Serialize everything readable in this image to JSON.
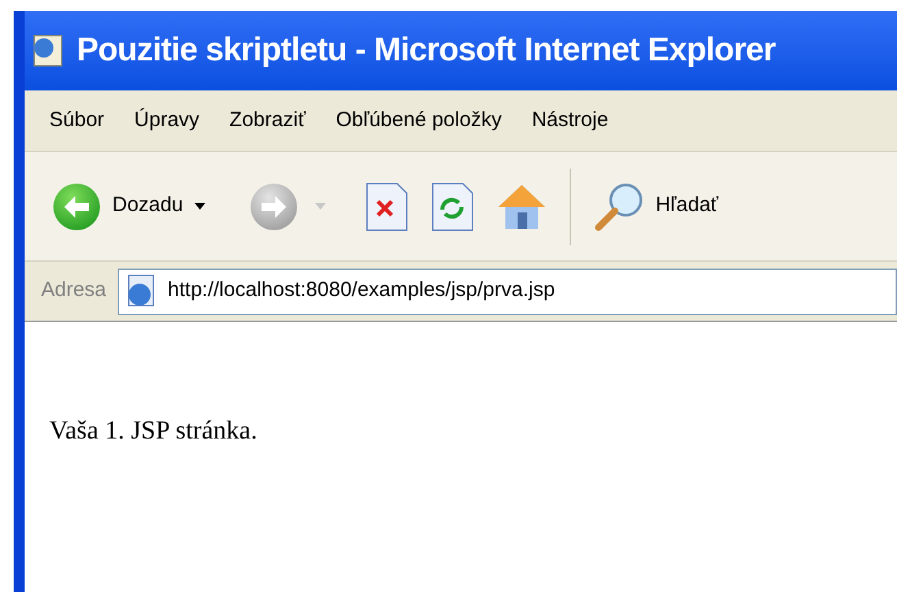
{
  "window": {
    "title": "Pouzitie skriptletu - Microsoft Internet Explorer"
  },
  "menu": [
    "Súbor",
    "Úpravy",
    "Zobraziť",
    "Obľúbené položky",
    "Nástroje"
  ],
  "toolbar": {
    "back": {
      "label": "Dozadu",
      "disabled": false
    },
    "forward": {
      "disabled": true
    },
    "search": {
      "label": "Hľadať"
    }
  },
  "address": {
    "label": "Adresa",
    "value": "http://localhost:8080/examples/jsp/prva.jsp"
  },
  "page": {
    "text": "Vaša 1. JSP stránka."
  }
}
